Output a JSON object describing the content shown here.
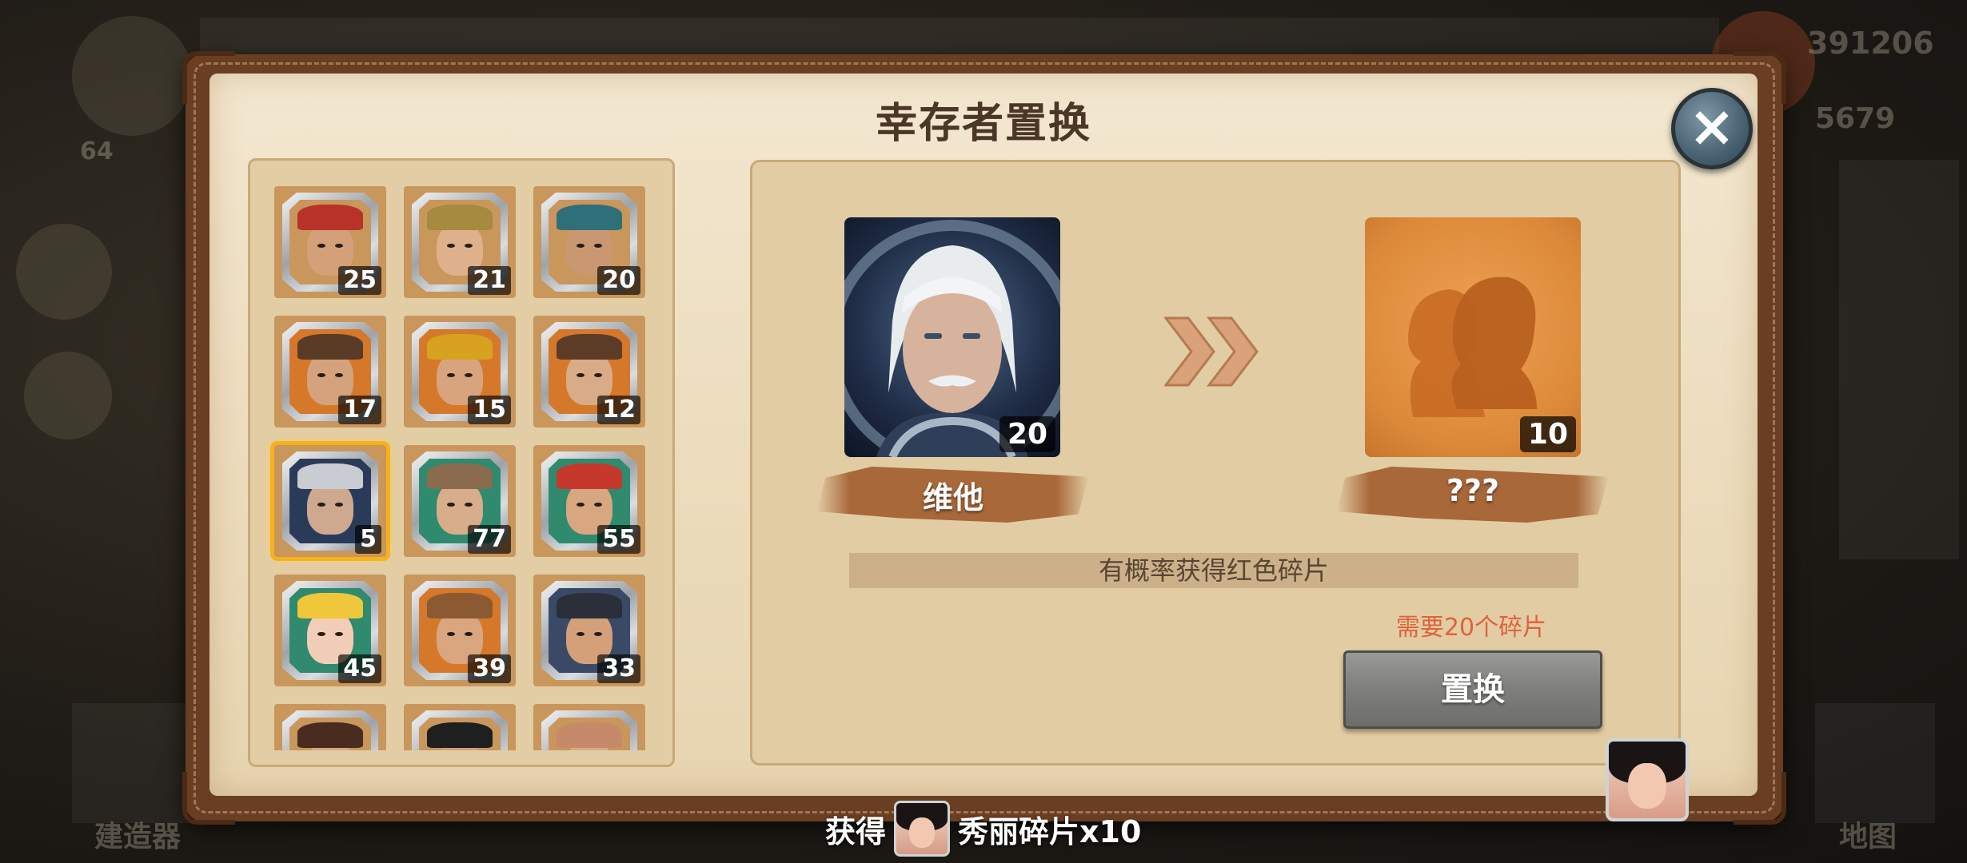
{
  "background": {
    "top_number_1": "391206",
    "top_number_2": "5679",
    "level_badge": "64",
    "left_bottom_label": "建造器",
    "right_bottom_label": "地图"
  },
  "dialog": {
    "title": "幸存者置换",
    "close_icon": "close-icon"
  },
  "grid": {
    "cells": [
      {
        "count": "25",
        "hat": "#b8322a",
        "skin": "#d3a07a",
        "bg": "#c9965c",
        "selected": false
      },
      {
        "count": "21",
        "hat": "#a58a40",
        "skin": "#dfb08c",
        "bg": "#c9965c",
        "selected": false
      },
      {
        "count": "20",
        "hat": "#2f6f7a",
        "skin": "#c99872",
        "bg": "#c9965c",
        "selected": false
      },
      {
        "count": "17",
        "hat": "#5a3b25",
        "skin": "#d4a27c",
        "bg": "#d5782a",
        "selected": false
      },
      {
        "count": "15",
        "hat": "#d6a21f",
        "skin": "#d8a47e",
        "bg": "#d5782a",
        "selected": false
      },
      {
        "count": "12",
        "hat": "#5c3c27",
        "skin": "#d9ab87",
        "bg": "#d5782a",
        "selected": false
      },
      {
        "count": "5",
        "hat": "#c9ccd2",
        "skin": "#cfa890",
        "bg": "#2a3b5a",
        "selected": true
      },
      {
        "count": "77",
        "hat": "#8a6b4d",
        "skin": "#d8ad8c",
        "bg": "#2f8a6e",
        "selected": false
      },
      {
        "count": "55",
        "hat": "#c7382c",
        "skin": "#d8a681",
        "bg": "#2f8a6e",
        "selected": false
      },
      {
        "count": "45",
        "hat": "#f0c73a",
        "skin": "#f2cdb8",
        "bg": "#2f8a6e",
        "selected": false
      },
      {
        "count": "39",
        "hat": "#8c5a32",
        "skin": "#d9a680",
        "bg": "#d5782a",
        "selected": false
      },
      {
        "count": "33",
        "hat": "#2b2f3a",
        "skin": "#d3a07a",
        "bg": "#3a4a66",
        "selected": false
      },
      {
        "count": "",
        "hat": "#4a2b20",
        "skin": "#d6a686",
        "bg": "#c9965c",
        "selected": false
      },
      {
        "count": "",
        "hat": "#1f1f1f",
        "skin": "#d2a07a",
        "bg": "#c9965c",
        "selected": false
      },
      {
        "count": "",
        "hat": "#c68a6a",
        "skin": "#d9ab87",
        "bg": "#c9965c",
        "selected": false
      }
    ]
  },
  "exchange": {
    "source_name": "维他",
    "source_count": "20",
    "target_name": "???",
    "target_count": "10",
    "arrow_icon": "double-chevron-right-icon",
    "hint": "有概率获得红色碎片",
    "requirement": "需要20个碎片",
    "swap_label": "置换"
  },
  "toast": {
    "prefix": "获得",
    "item": "秀丽碎片x10"
  },
  "colors": {
    "frame_brown": "#6a3e22",
    "parchment": "#f3e7d0",
    "panel": "#e2cca4",
    "selected_border": "#f7b119",
    "requirement_red": "#e0623b",
    "button_gray": "#7e7e7a"
  }
}
